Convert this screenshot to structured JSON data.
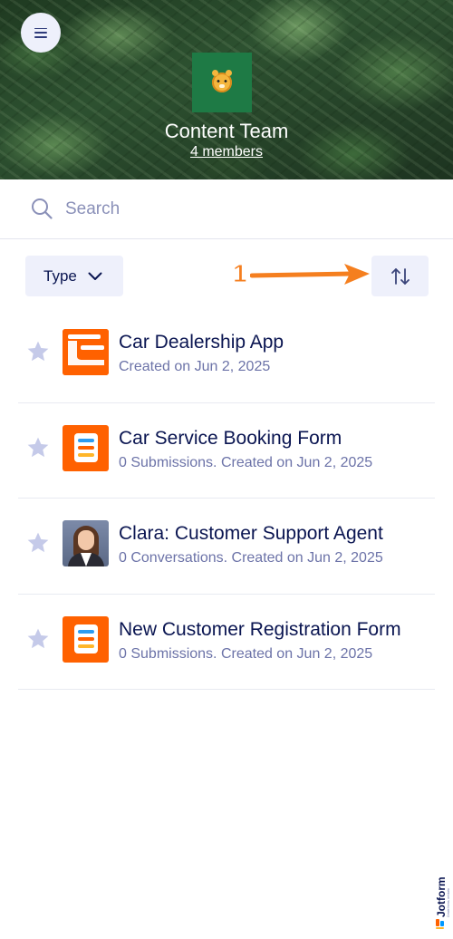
{
  "header": {
    "team_name": "Content Team",
    "members_link": "4 members"
  },
  "search": {
    "placeholder": "Search"
  },
  "controls": {
    "type_label": "Type",
    "annotation_number": "1"
  },
  "items": [
    {
      "title": "Car Dealership App",
      "subtitle": "Created on Jun 2, 2025",
      "kind": "app"
    },
    {
      "title": "Car Service Booking Form",
      "subtitle": "0 Submissions. Created on Jun 2, 2025",
      "kind": "form"
    },
    {
      "title": "Clara: Customer Support Agent",
      "subtitle": "0 Conversations. Created on Jun 2, 2025",
      "kind": "agent"
    },
    {
      "title": "New Customer Registration Form",
      "subtitle": "0 Submissions. Created on Jun 2, 2025",
      "kind": "form"
    }
  ],
  "brand": {
    "name": "Jotform"
  },
  "colors": {
    "accent_orange": "#ff6100",
    "navy": "#0a1551",
    "muted": "#6c73a8",
    "control_bg": "#eef0fb",
    "team_logo_bg": "#1e7a45",
    "annotation": "#f57f1f"
  }
}
